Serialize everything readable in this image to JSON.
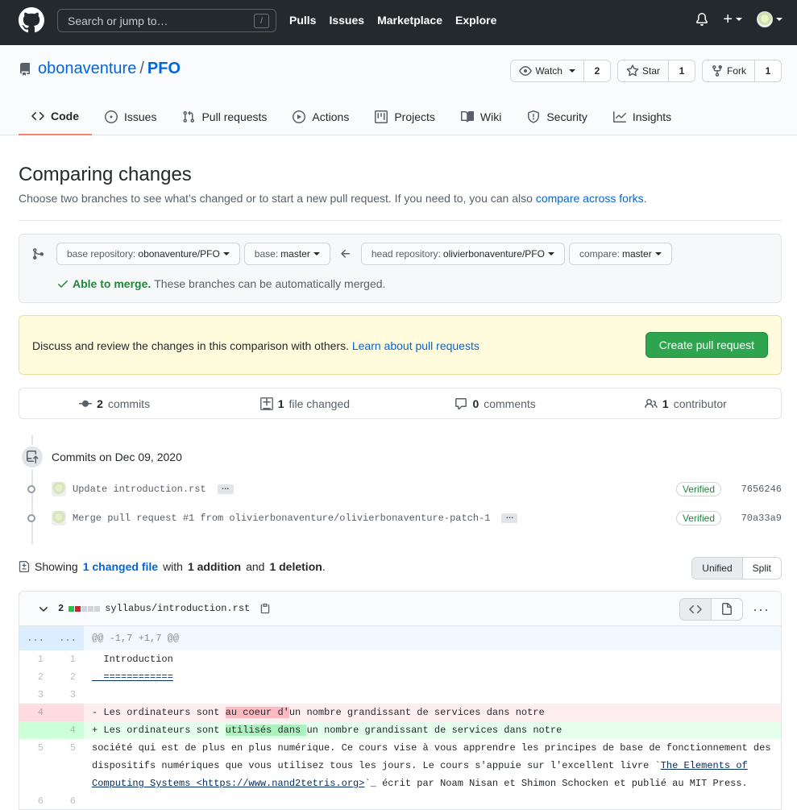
{
  "header": {
    "search_placeholder": "Search or jump to…",
    "search_key": "/",
    "nav": [
      "Pulls",
      "Issues",
      "Marketplace",
      "Explore"
    ]
  },
  "repo": {
    "owner": "obonaventure",
    "separator": "/",
    "name": "PFO",
    "watch_label": "Watch",
    "watch_count": "2",
    "star_label": "Star",
    "star_count": "1",
    "fork_label": "Fork",
    "fork_count": "1",
    "tabs": [
      "Code",
      "Issues",
      "Pull requests",
      "Actions",
      "Projects",
      "Wiki",
      "Security",
      "Insights"
    ]
  },
  "compare": {
    "title": "Comparing changes",
    "description": "Choose two branches to see what’s changed or to start a new pull request. If you need to, you can also",
    "description_link": "compare across forks",
    "description_end": ".",
    "base_repo_label": "base repository:",
    "base_repo_value": "obonaventure/PFO",
    "base_label": "base:",
    "base_value": "master",
    "head_repo_label": "head repository:",
    "head_repo_value": "olivierbonaventure/PFO",
    "compare_label": "compare:",
    "compare_value": "master",
    "merge_ok": "Able to merge.",
    "merge_text": "These branches can be automatically merged."
  },
  "flash": {
    "text": "Discuss and review the changes in this comparison with others.",
    "link": "Learn about pull requests",
    "button": "Create pull request"
  },
  "numbers": {
    "commits_count": "2",
    "commits_label": "commits",
    "files_count": "1",
    "files_label": "file changed",
    "comments_count": "0",
    "comments_label": "comments",
    "contributors_count": "1",
    "contributors_label": "contributor"
  },
  "commits": {
    "date_label": "Commits on Dec 09, 2020",
    "items": [
      {
        "message": "Update introduction.rst",
        "verified": "Verified",
        "sha": "7656246"
      },
      {
        "message": "Merge pull request #1 from olivierbonaventure/olivierbonaventure-patch-1",
        "verified": "Verified",
        "sha": "70a33a9"
      }
    ]
  },
  "toc": {
    "showing": "Showing",
    "changed_link": "1 changed file",
    "with": "with",
    "additions": "1 addition",
    "and": "and",
    "deletions": "1 deletion",
    "end": ".",
    "unified": "Unified",
    "split": "Split"
  },
  "file": {
    "changes": "2",
    "name": "syllabus/introduction.rst",
    "hunk_left": "...",
    "hunk_right": "...",
    "hunk_header": "@@ -1,7 +1,7 @@",
    "lines": [
      {
        "old": "1",
        "new": "1",
        "text": "  Introduction"
      },
      {
        "old": "2",
        "new": "2",
        "text": "  ============"
      },
      {
        "old": "3",
        "new": "3",
        "text": ""
      },
      {
        "old": "4",
        "new": "",
        "pre": "- Les ordinateurs sont ",
        "hl": "au coeur d'",
        "post": "un nombre grandissant de services dans notre"
      },
      {
        "old": "",
        "new": "4",
        "pre": "+ Les ordinateurs sont ",
        "hl": "utilisés dans ",
        "post": "un nombre grandissant de services dans notre"
      },
      {
        "old": "5",
        "new": "5",
        "a": "  société qui est de plus en plus numérique. Ce cours vise à vous apprendre les principes de base de fonctionnement des dispositifs numériques que vous utilisez tous les jours. Le cours s'appuie sur l'excellent livre `",
        "u": "The Elements of Computing Systems <https://www.nand2tetris.org>",
        "b": "`_ écrit par Noam Nisan et Shimon Schocken et publié au MIT Press."
      },
      {
        "old": "6",
        "new": "6",
        "text": ""
      }
    ]
  }
}
